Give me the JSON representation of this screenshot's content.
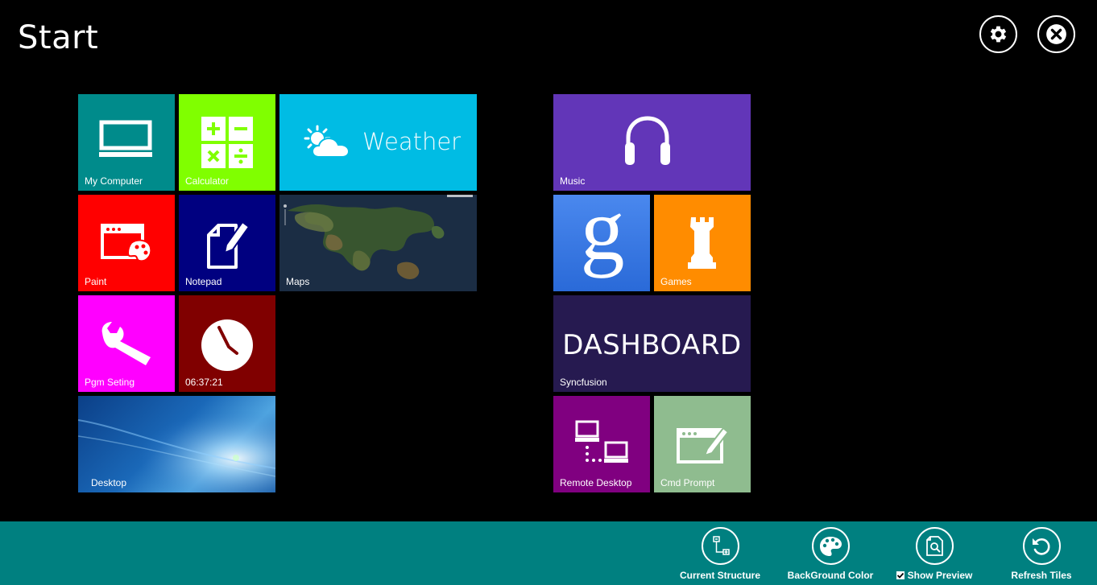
{
  "header": {
    "title": "Start",
    "settings_icon": "gear-icon",
    "close_icon": "close-icon"
  },
  "colors": {
    "background": "#000000",
    "bottom_bar": "#008080",
    "my_computer": "#008B8B",
    "calculator": "#80FF00",
    "weather": "#00BCE4",
    "paint": "#FF0000",
    "notepad": "#000080",
    "pgm_seting": "#FF00FF",
    "clock": "#800000",
    "music": "#6236B8",
    "google": "#3A7BE5",
    "games": "#FF8C00",
    "syncfusion": "#261A50",
    "remote_desktop": "#800080",
    "cmd_prompt": "#8FBC8F"
  },
  "tiles": {
    "my_computer": {
      "label": "My Computer",
      "icon": "monitor-icon"
    },
    "calculator": {
      "label": "Calculator",
      "icon": "calculator-icon"
    },
    "weather": {
      "title": "Weather",
      "icon": "weather-icon"
    },
    "paint": {
      "label": "Paint",
      "icon": "paint-icon"
    },
    "notepad": {
      "label": "Notepad",
      "icon": "notepad-icon"
    },
    "maps": {
      "label": "Maps"
    },
    "pgm_seting": {
      "label": "Pgm Seting",
      "icon": "wrench-icon"
    },
    "clock": {
      "label": "06:37:21",
      "icon": "clock-icon"
    },
    "desktop": {
      "label": "Desktop"
    },
    "music": {
      "label": "Music",
      "icon": "headphones-icon"
    },
    "google": {
      "icon": "google-icon"
    },
    "games": {
      "label": "Games",
      "icon": "chess-rook-icon"
    },
    "syncfusion": {
      "title": "DASHBOARD",
      "label": "Syncfusion"
    },
    "remote_desktop": {
      "label": "Remote Desktop",
      "icon": "remote-desktop-icon"
    },
    "cmd_prompt": {
      "label": "Cmd Prompt",
      "icon": "cmd-prompt-icon"
    }
  },
  "bottom_bar": {
    "current_structure": {
      "label": "Current Structure",
      "icon": "structure-icon"
    },
    "background_color": {
      "label": "BackGround Color",
      "icon": "palette-icon"
    },
    "show_preview": {
      "label": "Show Preview",
      "icon": "preview-icon",
      "checked": true
    },
    "refresh_tiles": {
      "label": "Refresh Tiles",
      "icon": "refresh-icon"
    }
  }
}
